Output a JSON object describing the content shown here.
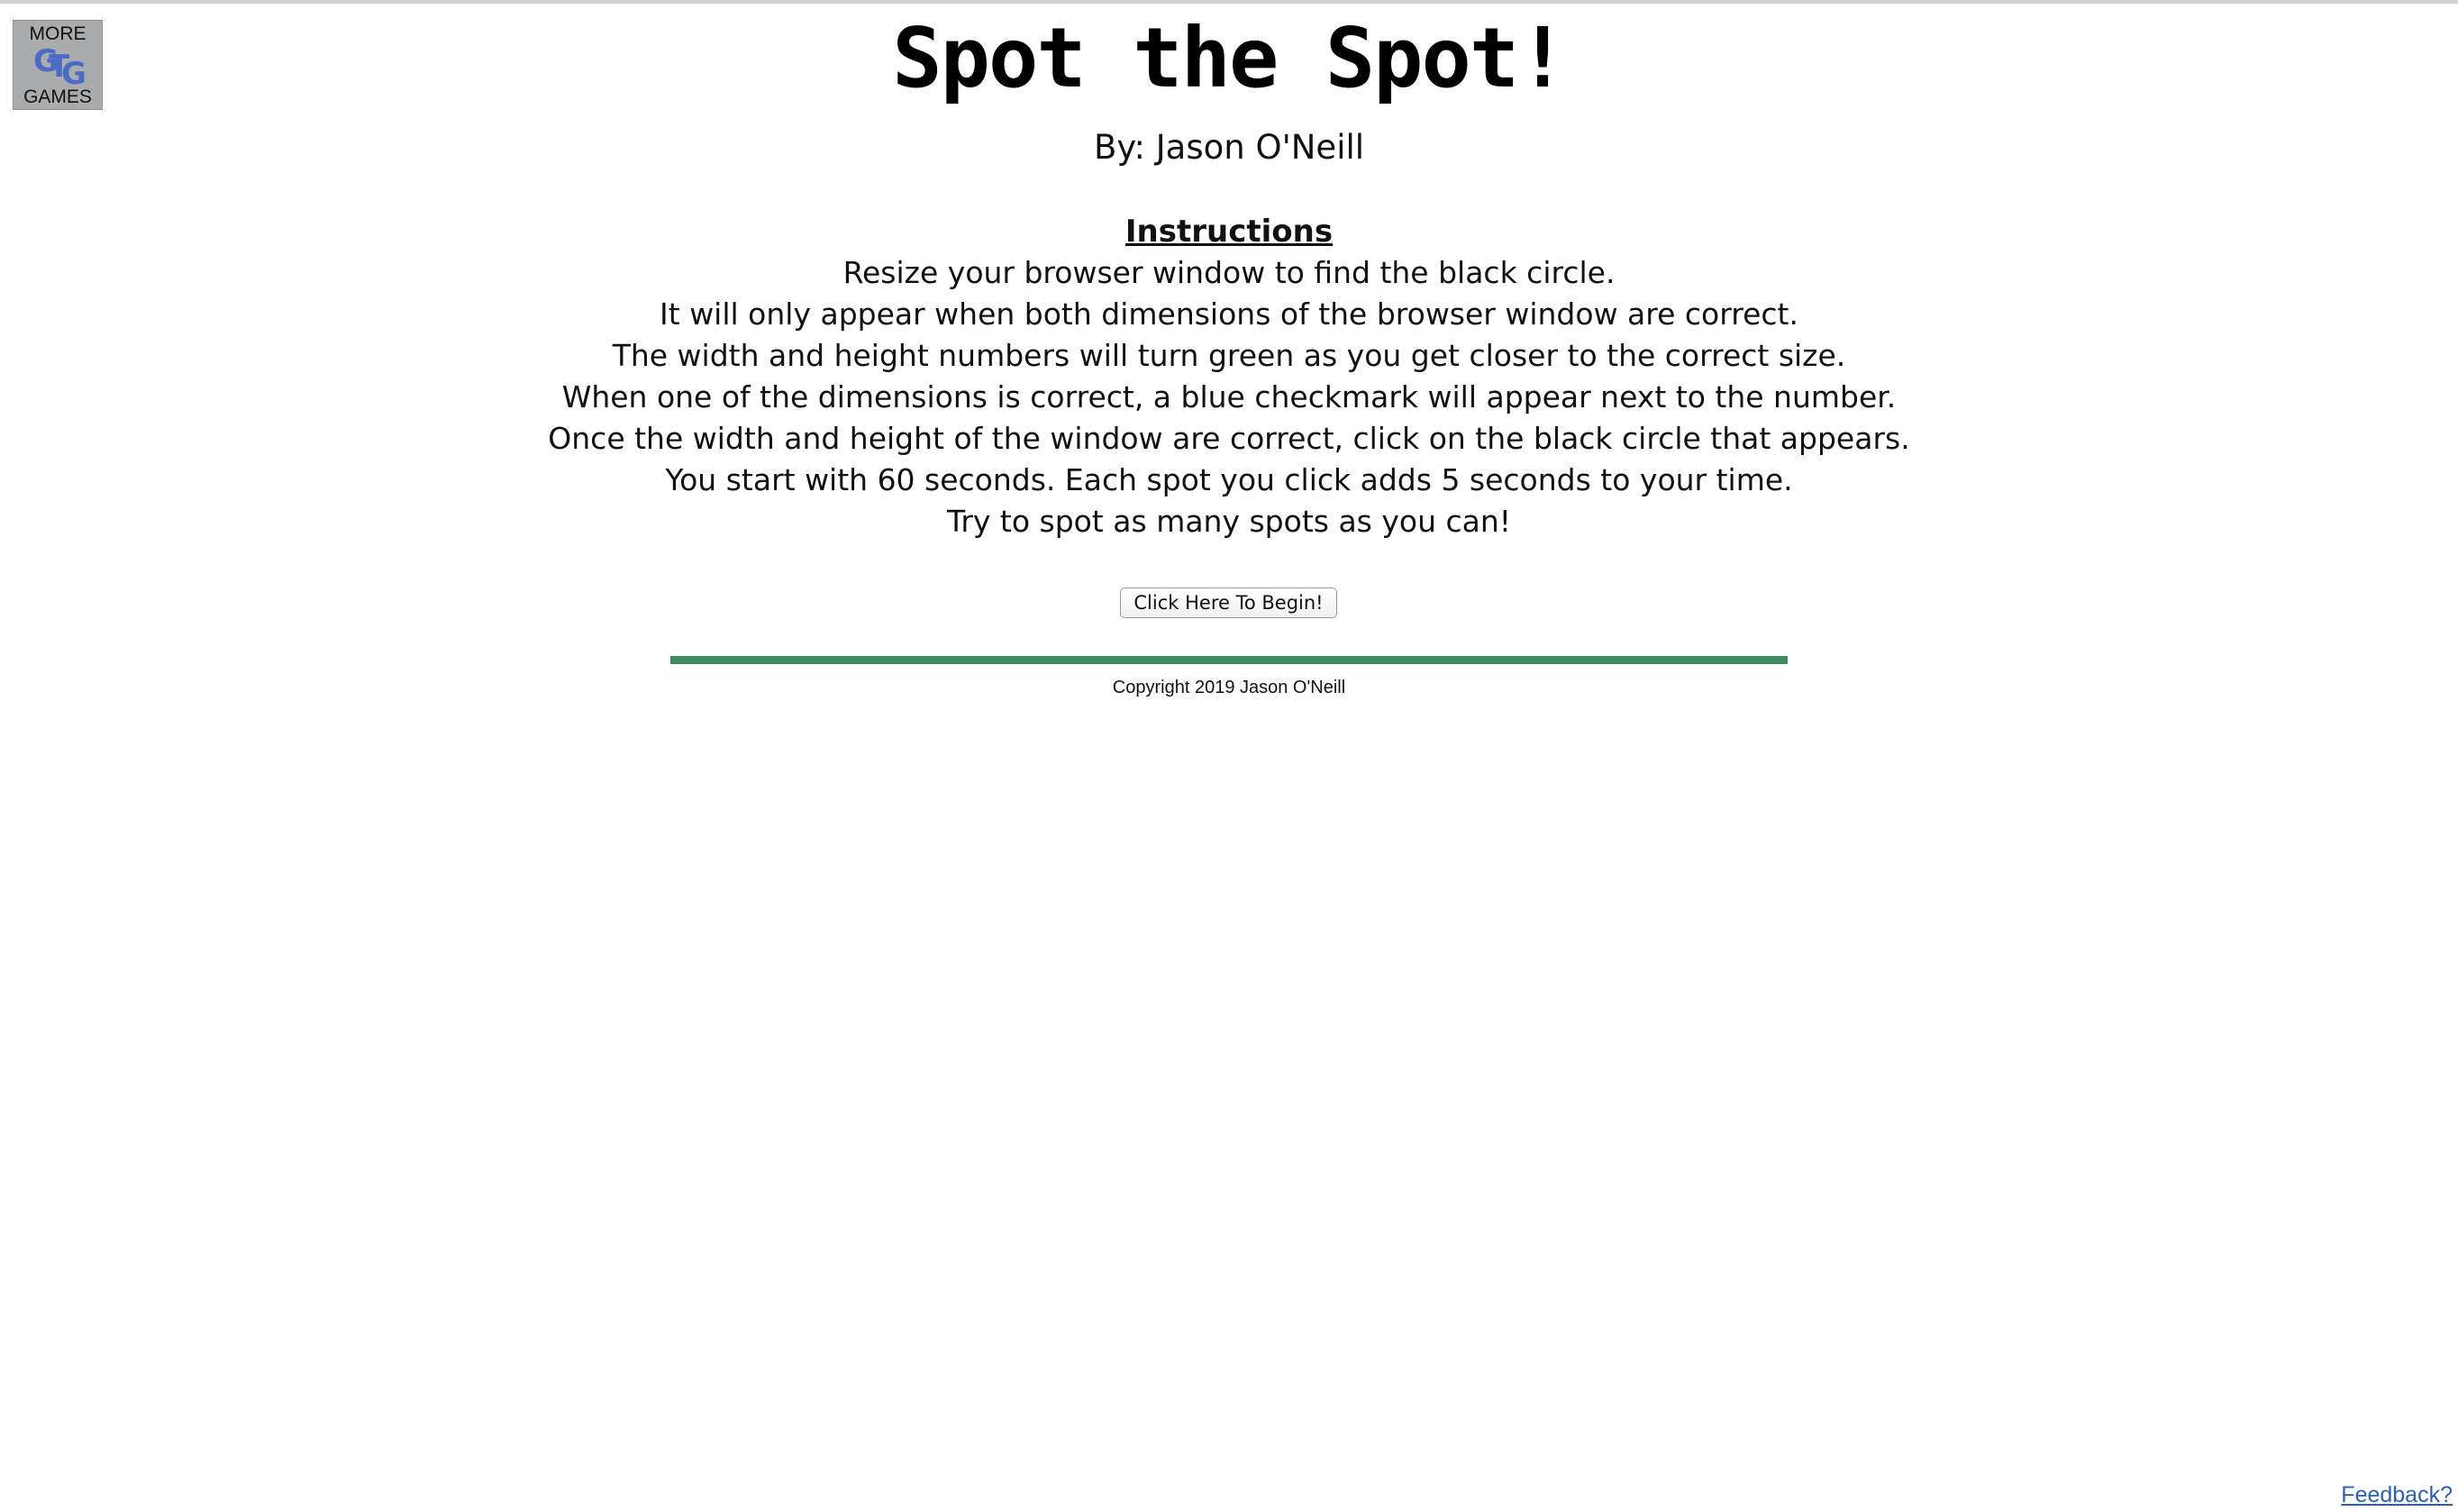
{
  "more_games": {
    "top_label": "MORE",
    "logo_text": "GTG",
    "bottom_label": "GAMES",
    "logo_color": "#4a6cc7",
    "background_color": "#a9abad"
  },
  "header": {
    "title": "Spot the Spot!",
    "byline": "By: Jason O'Neill"
  },
  "instructions": {
    "heading": "Instructions",
    "lines": [
      "Resize your browser window to find the black circle.",
      "It will only appear when both dimensions of the browser window are correct.",
      "The width and height numbers will turn green as you get closer to the correct size.",
      "When one of the dimensions is correct, a blue checkmark will appear next to the number.",
      "Once the width and height of the window are correct, click on the black circle that appears.",
      "You start with 60 seconds. Each spot you click adds 5 seconds to your time.",
      "Try to spot as many spots as you can!"
    ]
  },
  "begin_button": {
    "label": "Click Here To Begin!"
  },
  "divider": {
    "color": "#3e8a5c"
  },
  "footer": {
    "copyright": "Copyright 2019 Jason O'Neill",
    "feedback_link": "Feedback?"
  }
}
